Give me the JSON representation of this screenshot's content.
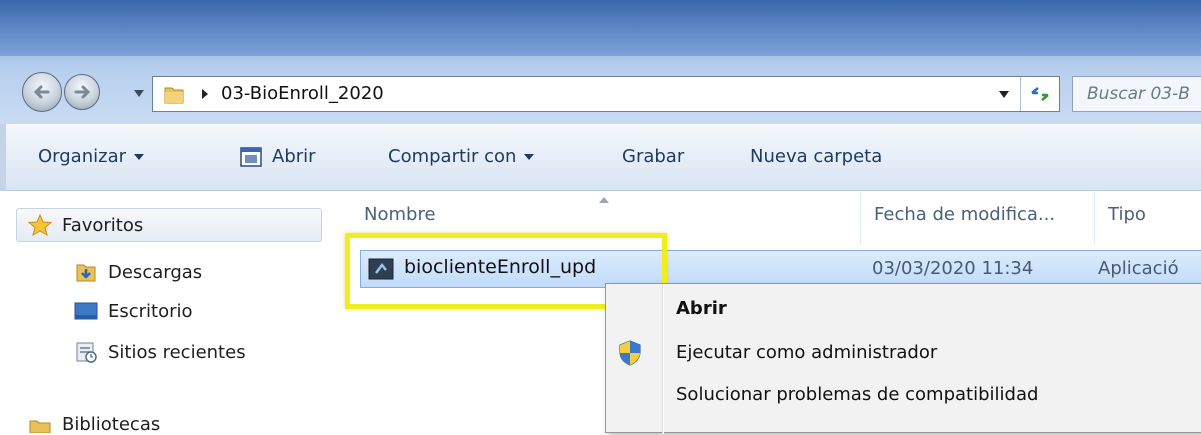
{
  "window": {
    "address": {
      "path": "03-BioEnroll_2020",
      "folder_icon": "folder-icon",
      "refresh_icon": "refresh-icon"
    },
    "search": {
      "placeholder": "Buscar 03-B"
    }
  },
  "toolbar": {
    "organize_label": "Organizar",
    "open_label": "Abrir",
    "share_label": "Compartir con",
    "burn_label": "Grabar",
    "new_folder_label": "Nueva carpeta"
  },
  "sidebar": {
    "favorites_label": "Favoritos",
    "items": [
      {
        "label": "Descargas",
        "icon": "downloads-folder-icon"
      },
      {
        "label": "Escritorio",
        "icon": "desktop-icon"
      },
      {
        "label": "Sitios recientes",
        "icon": "recent-places-icon"
      }
    ],
    "libraries_label": "Bibliotecas"
  },
  "filelist": {
    "columns": [
      "Nombre",
      "Fecha de modifica...",
      "Tipo"
    ],
    "rows": [
      {
        "name": "bioclienteEnroll_upd",
        "date": "03/03/2020 11:34",
        "type": "Aplicació"
      }
    ]
  },
  "context_menu": {
    "items": [
      {
        "label": "Abrir",
        "bold": true
      },
      {
        "label": "Ejecutar como administrador",
        "icon": "uac-shield-icon"
      },
      {
        "label": "Solucionar problemas de compatibilidad"
      }
    ]
  },
  "colors": {
    "highlight_box": "#f2ee1c",
    "selection": "#c1dcfa",
    "toolbar_text": "#1e3a5f"
  }
}
